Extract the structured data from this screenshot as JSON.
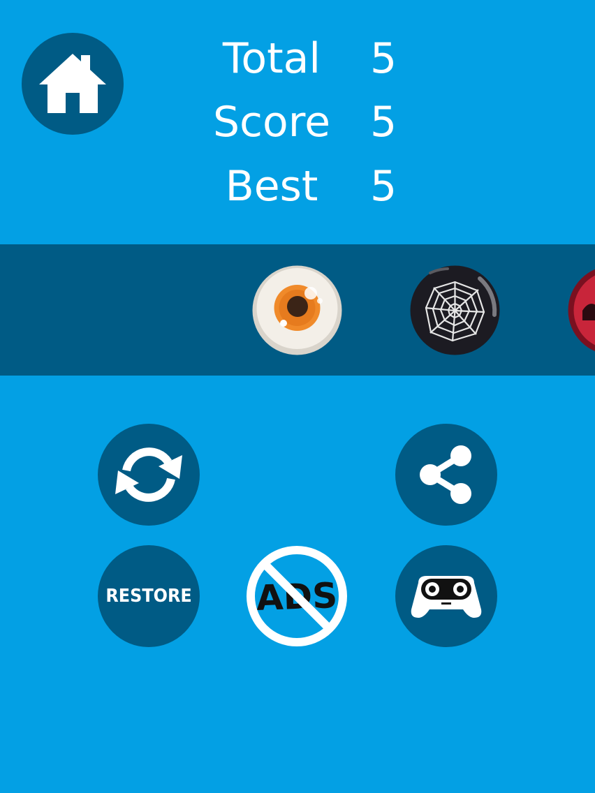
{
  "stats": {
    "total_label": "Total",
    "total_value": "5",
    "score_label": "Score",
    "score_value": "5",
    "best_label": "Best",
    "best_value": "5"
  },
  "buttons": {
    "restore_label": "RESTORE",
    "noads_label": "ADS"
  },
  "icons": {
    "home": "home-icon",
    "replay": "refresh-icon",
    "share": "share-icon",
    "games": "gamepad-icon",
    "noads": "no-ads-icon"
  },
  "skins": [
    "eyeball-ball",
    "spider-web-ball",
    "red-ball"
  ],
  "colors": {
    "background": "#03a0e4",
    "band": "#005b85",
    "button": "#005b85",
    "text": "#ffffff"
  }
}
